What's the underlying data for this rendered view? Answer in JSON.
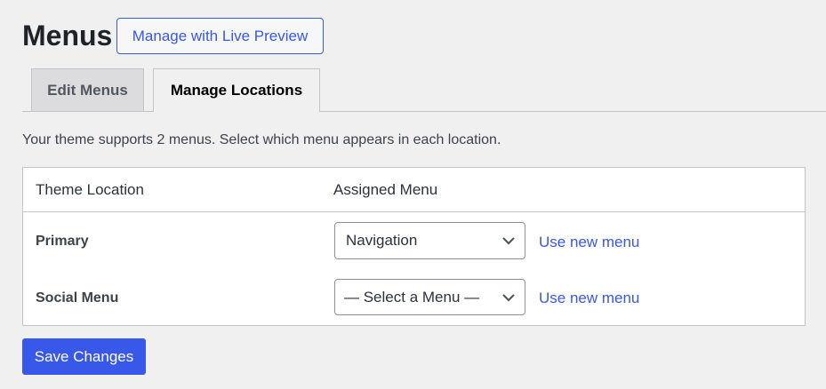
{
  "header": {
    "title": "Menus",
    "live_preview_label": "Manage with Live Preview"
  },
  "tabs": [
    {
      "label": "Edit Menus",
      "active": false
    },
    {
      "label": "Manage Locations",
      "active": true
    }
  ],
  "description": "Your theme supports 2 menus. Select which menu appears in each location.",
  "table": {
    "columns": [
      "Theme Location",
      "Assigned Menu"
    ],
    "rows": [
      {
        "location": "Primary",
        "menu": "Navigation",
        "link": "Use new menu"
      },
      {
        "location": "Social Menu",
        "menu": "— Select a Menu —",
        "link": "Use new menu"
      }
    ]
  },
  "save_label": "Save Changes",
  "colors": {
    "accent": "#3858e9",
    "background": "#f0f0f1"
  }
}
